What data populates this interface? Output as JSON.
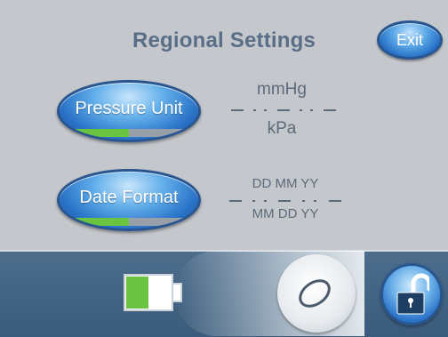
{
  "header": {
    "title": "Regional Settings",
    "exit_label": "Exit"
  },
  "settings": [
    {
      "label": "Pressure Unit",
      "options": [
        "mmHg",
        "kPa"
      ],
      "selected": "mmHg"
    },
    {
      "label": "Date Format",
      "options": [
        "DD MM YY",
        "MM DD YY"
      ],
      "selected": "DD MM YY"
    }
  ],
  "status_bar": {
    "battery_icon": "battery-icon",
    "battery_level": 0.5,
    "slider_icon": "unlock-slider-knob",
    "lock_icon": "open-padlock-icon"
  },
  "colors": {
    "background": "#c4c7cc",
    "title": "#5a6f87",
    "button_blue": "#2a73c8",
    "button_border": "#2a5690",
    "indicator_green": "#6bc441",
    "indicator_gray": "#97a0a8",
    "bottom_bar": "#44648a",
    "option_text": "#5d6b7a"
  }
}
